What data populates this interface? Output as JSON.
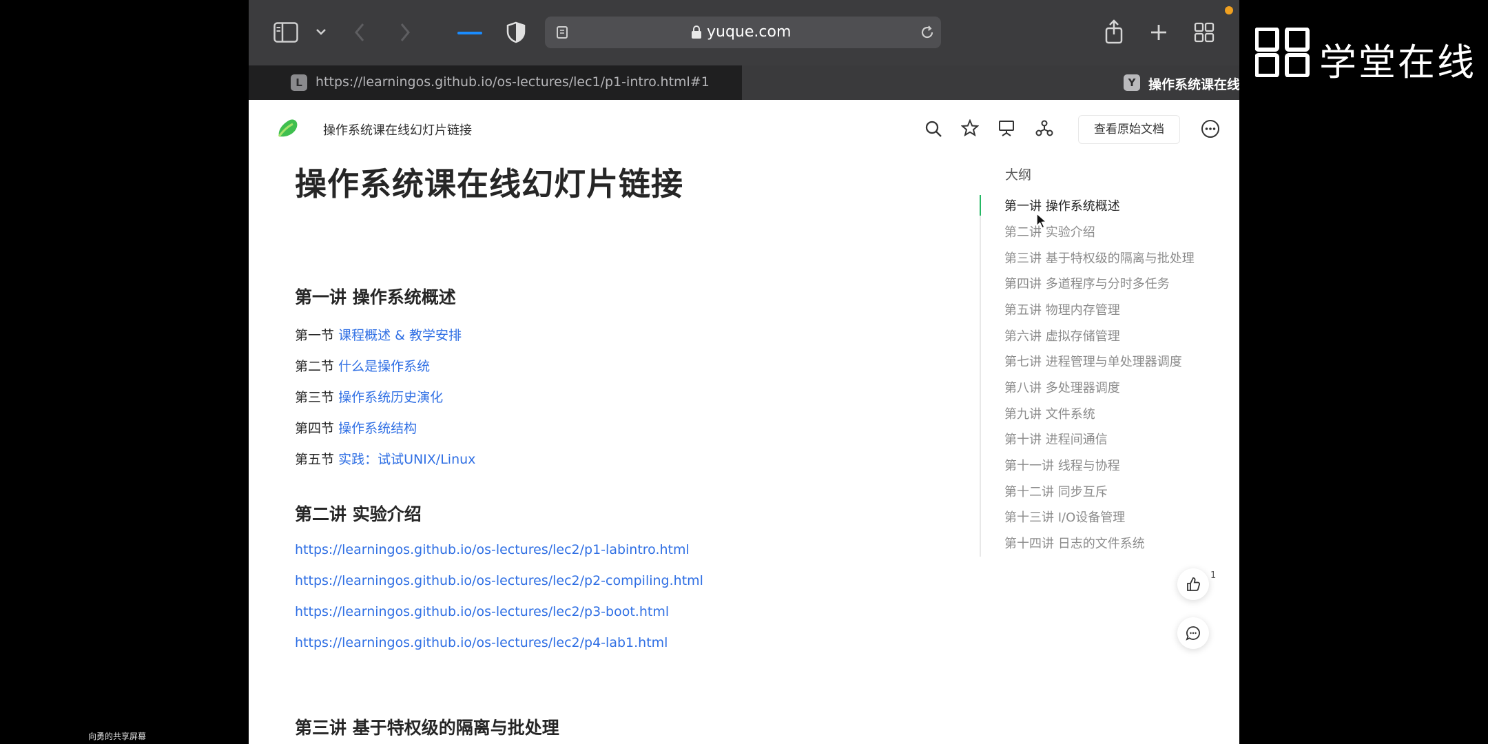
{
  "browser": {
    "address": "yuque.com",
    "tabs": [
      {
        "favicon_letter": "L",
        "title": "https://learningos.github.io/os-lectures/lec1/p1-intro.html#1"
      },
      {
        "favicon_letter": "Y",
        "title": "操作系统课在线幻灯片链接 · 语雀"
      }
    ]
  },
  "page": {
    "breadcrumb": "操作系统课在线幻灯片链接",
    "open_original": "查看原始文档",
    "title": "操作系统课在线幻灯片链接",
    "sections": [
      {
        "heading": "第一讲 操作系统概述",
        "rows": [
          {
            "prefix": "第一节",
            "link": "课程概述 & 教学安排"
          },
          {
            "prefix": "第二节",
            "link": "什么是操作系统"
          },
          {
            "prefix": "第三节",
            "link": "操作系统历史演化"
          },
          {
            "prefix": "第四节",
            "link": "操作系统结构"
          },
          {
            "prefix": "第五节",
            "link": "实践：试试UNIX/Linux"
          }
        ]
      },
      {
        "heading": "第二讲 实验介绍",
        "urls": [
          "https://learningos.github.io/os-lectures/lec2/p1-labintro.html",
          "https://learningos.github.io/os-lectures/lec2/p2-compiling.html",
          "https://learningos.github.io/os-lectures/lec2/p3-boot.html",
          "https://learningos.github.io/os-lectures/lec2/p4-lab1.html"
        ]
      },
      {
        "heading": "第三讲 基于特权级的隔离与批处理"
      }
    ]
  },
  "outline": {
    "heading": "大纲",
    "items": [
      "第一讲 操作系统概述",
      "第二讲 实验介绍",
      "第三讲 基于特权级的隔离与批处理",
      "第四讲 多道程序与分时多任务",
      "第五讲 物理内存管理",
      "第六讲 虚拟存储管理",
      "第七讲 进程管理与单处理器调度",
      "第八讲 多处理器调度",
      "第九讲 文件系统",
      "第十讲 进程间通信",
      "第十一讲 线程与协程",
      "第十二讲 同步互斥",
      "第十三讲 I/O设备管理",
      "第十四讲 日志的文件系统"
    ],
    "active_index": 0
  },
  "like_count": "1",
  "brand": "学堂在线",
  "share_caption": "向勇的共享屏幕",
  "colors": {
    "link": "#2f6fe4",
    "accent": "#25b864",
    "toolbar": "#3c3c3e"
  }
}
